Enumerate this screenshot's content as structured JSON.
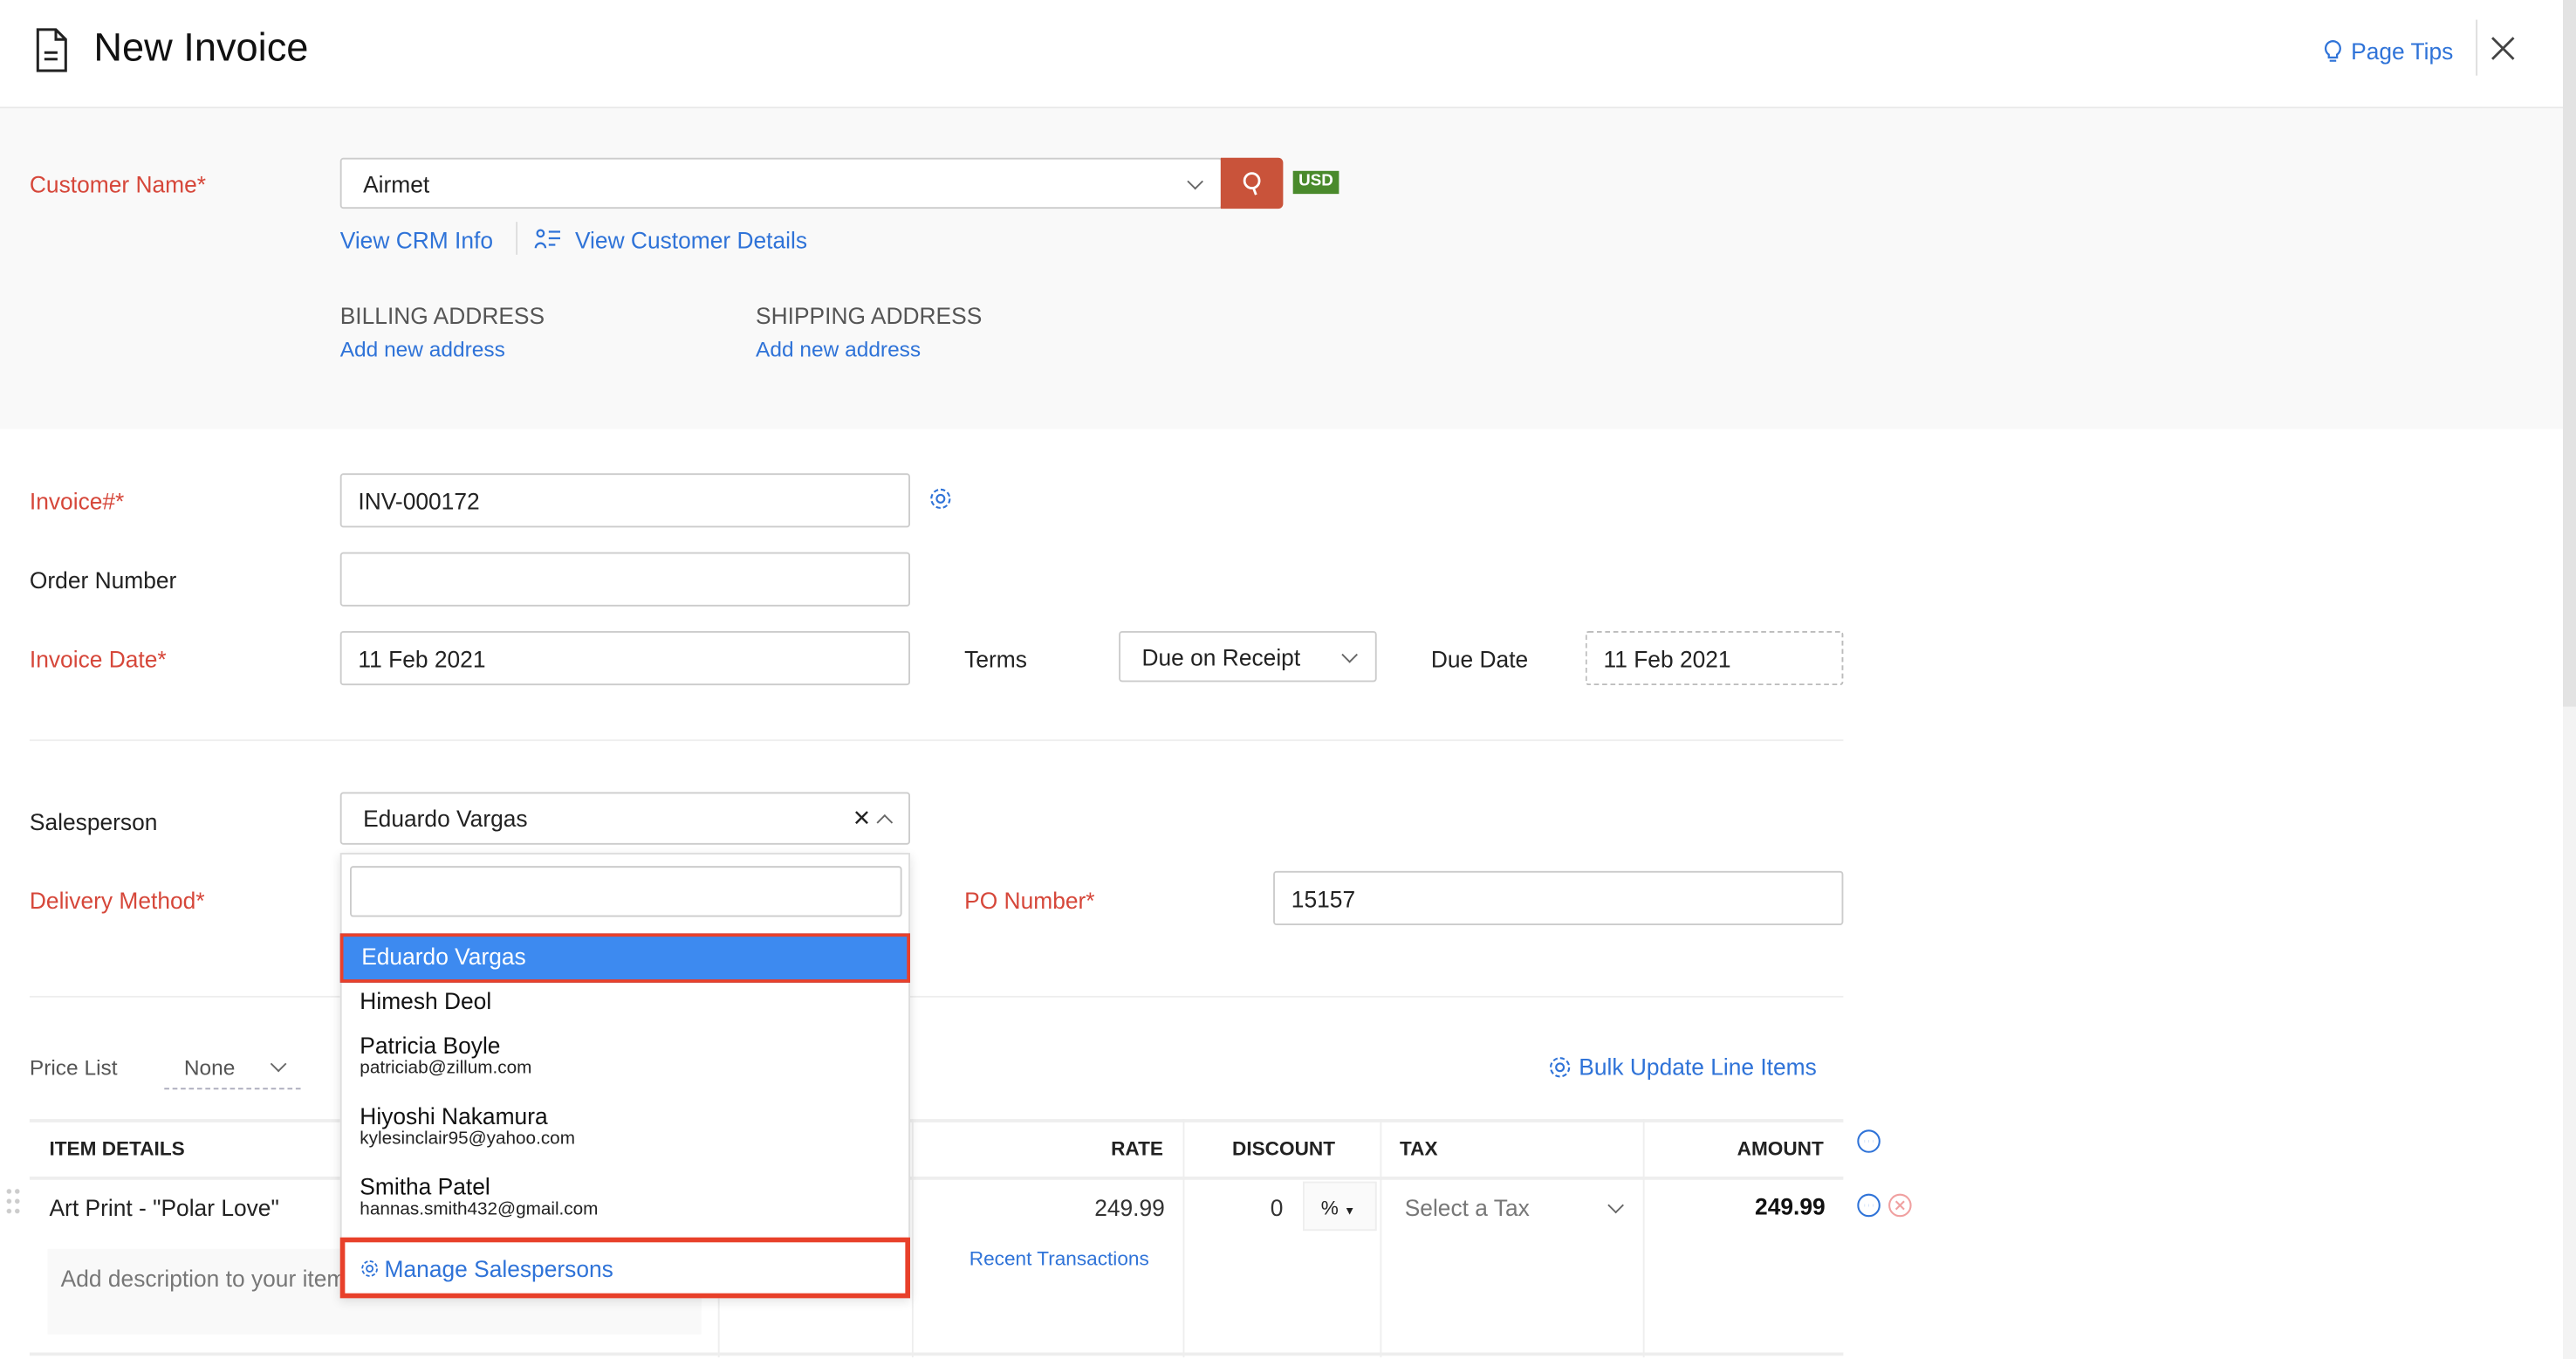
{
  "header": {
    "title": "New Invoice",
    "page_tips": "Page Tips"
  },
  "customer": {
    "label": "Customer Name*",
    "value": "Airmet",
    "currency": "USD",
    "view_crm": "View CRM Info",
    "view_details": "View Customer Details",
    "billing_title": "BILLING ADDRESS",
    "billing_link": "Add new address",
    "shipping_title": "SHIPPING ADDRESS",
    "shipping_link": "Add new address"
  },
  "form": {
    "invoice_label": "Invoice#*",
    "invoice_value": "INV-000172",
    "order_label": "Order Number",
    "order_value": "",
    "date_label": "Invoice Date*",
    "date_value": "11 Feb 2021",
    "terms_label": "Terms",
    "terms_value": "Due on Receipt",
    "due_label": "Due Date",
    "due_value": "11 Feb 2021",
    "salesperson_label": "Salesperson",
    "salesperson_value": "Eduardo Vargas",
    "delivery_label": "Delivery Method*",
    "po_label": "PO Number*",
    "po_value": "15157"
  },
  "dropdown": {
    "search_value": "",
    "items": [
      {
        "name": "Eduardo Vargas",
        "email": ""
      },
      {
        "name": "Himesh Deol",
        "email": ""
      },
      {
        "name": "Patricia Boyle",
        "email": "patriciab@zillum.com"
      },
      {
        "name": "Hiyoshi Nakamura",
        "email": "kylesinclair95@yahoo.com"
      },
      {
        "name": "Smitha Patel",
        "email": "hannas.smith432@gmail.com"
      }
    ],
    "manage": "Manage Salespersons"
  },
  "pricelist": {
    "label": "Price List",
    "value": "None",
    "bulk_update": "Bulk Update Line Items"
  },
  "table": {
    "headers": {
      "item": "ITEM DETAILS",
      "rate": "RATE",
      "discount": "DISCOUNT",
      "tax": "TAX",
      "amount": "AMOUNT"
    },
    "row": {
      "item": "Art Print - \"Polar Love\"",
      "description_placeholder": "Add description to your item",
      "rate": "249.99",
      "discount": "0",
      "discount_unit": "%",
      "tax": "Select a Tax",
      "amount": "249.99",
      "recent": "Recent Transactions"
    }
  },
  "colors": {
    "required": "#d6473a",
    "link": "#2f73d8",
    "search_button": "#c9533a",
    "currency_badge": "#4a8a2c",
    "selected_item": "#3d8af0",
    "highlight_border": "#e8402a"
  }
}
